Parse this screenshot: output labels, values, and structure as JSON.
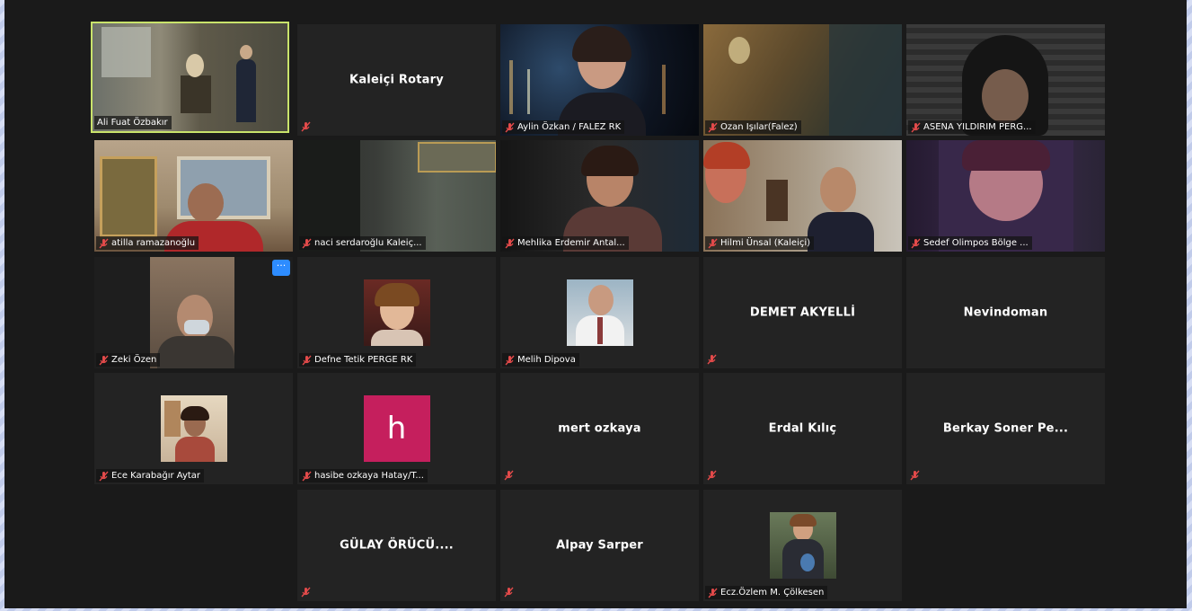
{
  "window": {
    "background": "#1a1a1a",
    "active_speaker_border": "#c9e36b"
  },
  "icons": {
    "muted_mic": "muted-mic-icon",
    "more": "more-options-icon"
  },
  "participants": [
    {
      "name": "Ali Fuat Özbakır",
      "center_label": "",
      "muted": false,
      "active": true,
      "type": "video"
    },
    {
      "name": "",
      "center_label": "Kaleiçi Rotary",
      "muted": true,
      "type": "name"
    },
    {
      "name": "Aylin Özkan / FALEZ RK",
      "center_label": "",
      "muted": true,
      "type": "video"
    },
    {
      "name": "Ozan Işılar(Falez)",
      "center_label": "",
      "muted": true,
      "type": "video"
    },
    {
      "name": "ASENA YILDIRIM PERG...",
      "center_label": "",
      "muted": true,
      "type": "video"
    },
    {
      "name": "atilla ramazanoğlu",
      "center_label": "",
      "muted": true,
      "type": "video"
    },
    {
      "name": "naci serdaroğlu  Kaleiç...",
      "center_label": "",
      "muted": true,
      "type": "video"
    },
    {
      "name": "Mehlika Erdemir Antal...",
      "center_label": "",
      "muted": true,
      "type": "video"
    },
    {
      "name": "Hilmi Ünsal (Kaleiçi)",
      "center_label": "",
      "muted": true,
      "type": "video"
    },
    {
      "name": "Sedef Olimpos Bölge ...",
      "center_label": "",
      "muted": true,
      "type": "video"
    },
    {
      "name": "Zeki Özen",
      "center_label": "",
      "muted": true,
      "type": "video",
      "more_label": "···"
    },
    {
      "name": "Defne Tetik PERGE RK",
      "center_label": "",
      "muted": true,
      "type": "photo"
    },
    {
      "name": "Melih Dipova",
      "center_label": "",
      "muted": true,
      "type": "photo"
    },
    {
      "name": "",
      "center_label": "DEMET AKYELLİ",
      "muted": true,
      "type": "name"
    },
    {
      "name": "",
      "center_label": "Nevindoman",
      "muted": false,
      "type": "name"
    },
    {
      "name": "Ece Karabağır Aytar",
      "center_label": "",
      "muted": true,
      "type": "photo"
    },
    {
      "name": "hasibe ozkaya Hatay/T...",
      "center_label": "",
      "muted": true,
      "type": "letter",
      "avatar_letter": "h"
    },
    {
      "name": "",
      "center_label": "mert ozkaya",
      "muted": true,
      "type": "name"
    },
    {
      "name": "",
      "center_label": "Erdal Kılıç",
      "muted": true,
      "type": "name"
    },
    {
      "name": "",
      "center_label": "Berkay Soner Pe...",
      "muted": true,
      "type": "name"
    },
    {
      "name": "",
      "center_label": "GÜLAY   ÖRÜCÜ....",
      "muted": true,
      "type": "name"
    },
    {
      "name": "",
      "center_label": "Alpay Sarper",
      "muted": true,
      "type": "name"
    },
    {
      "name": "Ecz.Özlem M. Çölkesen",
      "center_label": "",
      "muted": true,
      "type": "photo"
    }
  ]
}
